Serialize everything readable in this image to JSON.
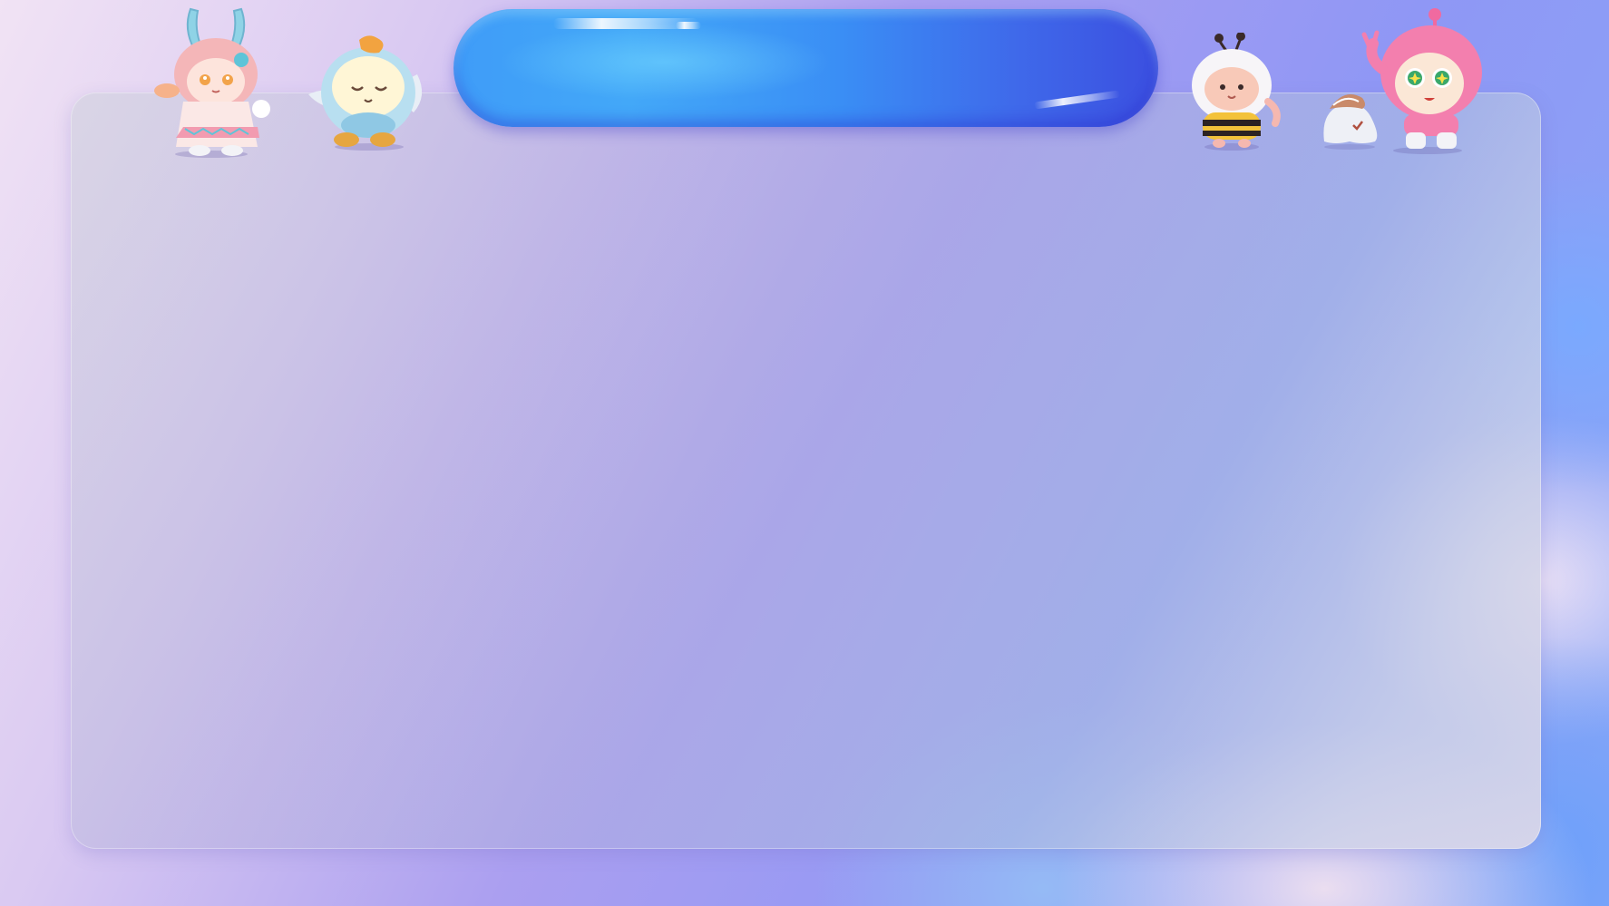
{
  "window": {
    "title": ""
  },
  "colors": {
    "panel_tint": "#b9b3e6",
    "title_pill_start": "#43a8f8",
    "title_pill_end": "#3b4fe0",
    "background_left": "#f1e3f4",
    "background_right": "#89a8f7"
  },
  "mascots": [
    {
      "name": "bunny-girl-mascot-icon"
    },
    {
      "name": "duck-costume-mascot-icon"
    },
    {
      "name": "bee-costume-mascot-icon"
    },
    {
      "name": "ghost-with-hat-mascot-icon"
    },
    {
      "name": "pink-hooded-mascot-icon"
    }
  ]
}
